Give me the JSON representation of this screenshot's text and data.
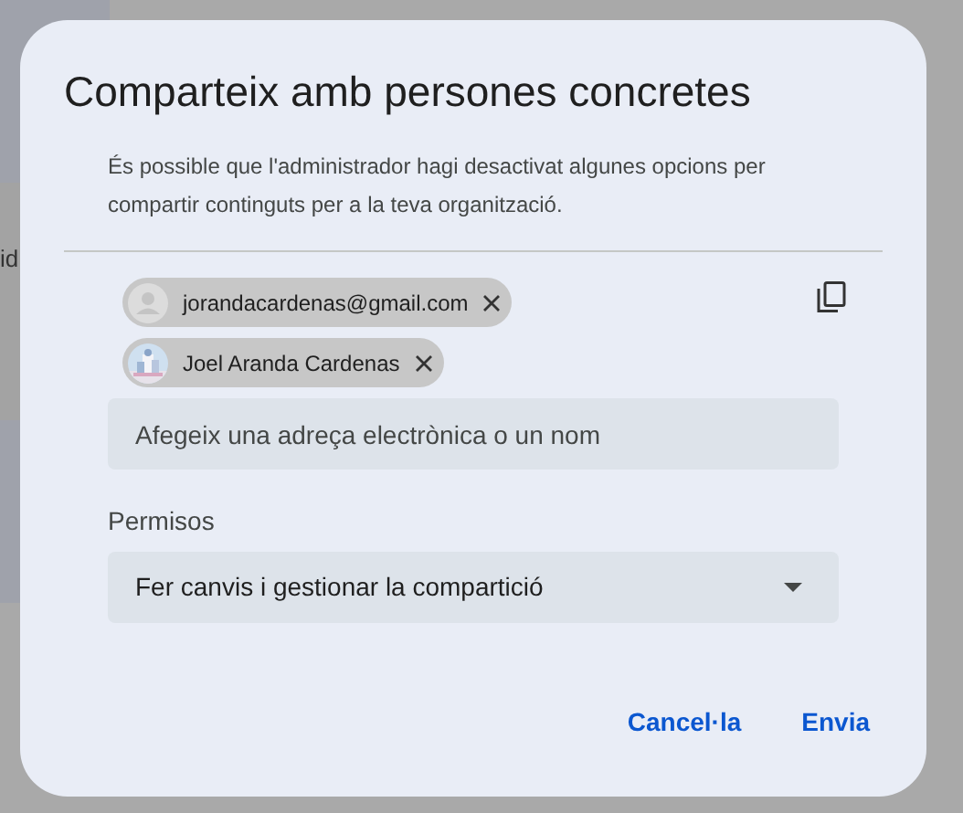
{
  "backdrop": {
    "text": "id"
  },
  "dialog": {
    "title": "Comparteix amb persones concretes",
    "note": "És possible que l'administrador hagi desactivat algunes opcions per compartir continguts per a la teva organització.",
    "recipients": [
      {
        "label": "jorandacardenas@gmail.com",
        "kind": "generic"
      },
      {
        "label": "Joel Aranda Cardenas",
        "kind": "picture"
      }
    ],
    "input": {
      "placeholder": "Afegeix una adreça electrònica o un nom"
    },
    "permissions": {
      "label": "Permisos",
      "value": "Fer canvis i gestionar la compartició"
    },
    "buttons": [
      "Cancel·la",
      "Envia"
    ]
  }
}
